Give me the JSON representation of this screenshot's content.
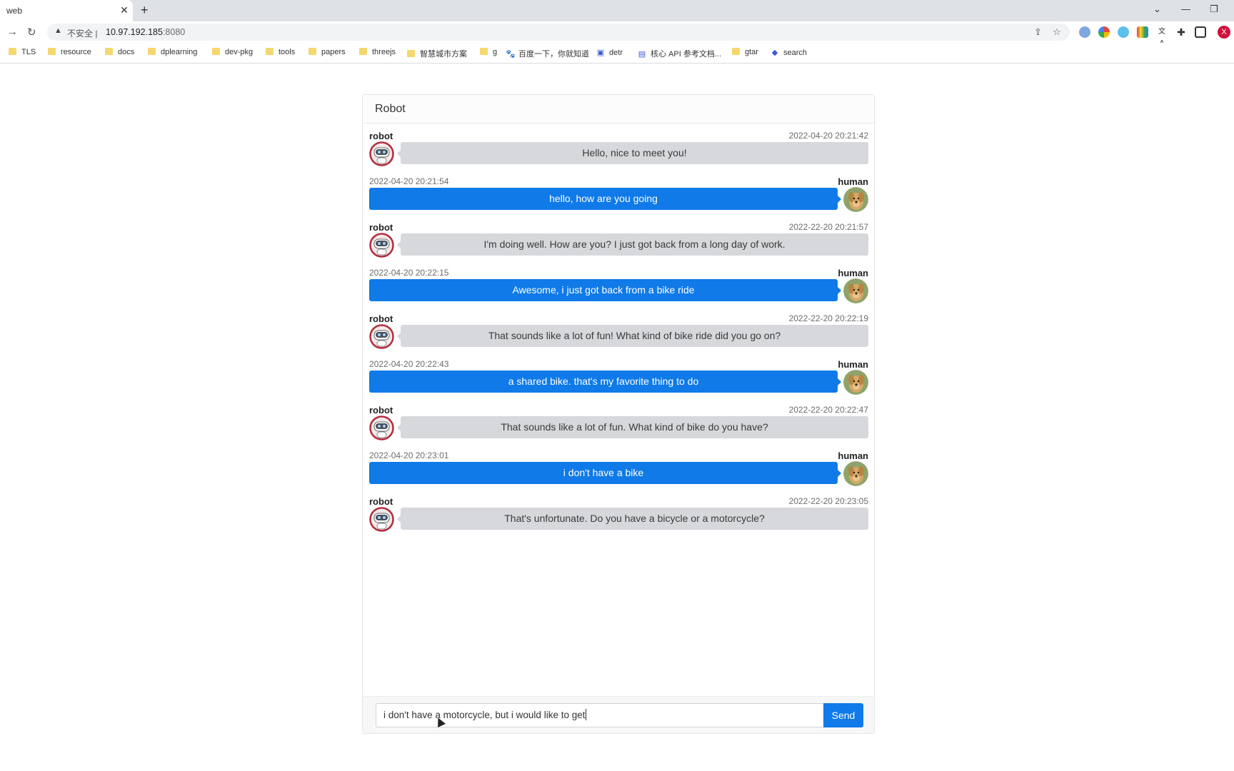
{
  "browser": {
    "tab_title": "web",
    "tab_close": "✕",
    "new_tab": "+",
    "insecure_label": "不安全 |",
    "url_host": "10.97.192.185",
    "url_port": ":8080",
    "profile_initial": "X",
    "bookmarks": [
      {
        "label": "TLS",
        "icon": "folder-icon"
      },
      {
        "label": "resource",
        "icon": "folder-icon"
      },
      {
        "label": "docs",
        "icon": "folder-icon"
      },
      {
        "label": "dplearning",
        "icon": "folder-icon"
      },
      {
        "label": "dev-pkg",
        "icon": "folder-icon"
      },
      {
        "label": "tools",
        "icon": "folder-icon"
      },
      {
        "label": "papers",
        "icon": "folder-icon"
      },
      {
        "label": "threejs",
        "icon": "folder-icon"
      },
      {
        "label": "智慧城市方案",
        "icon": "folder-icon"
      },
      {
        "label": "g",
        "icon": "folder-icon"
      },
      {
        "label": "百度一下，你就知道",
        "icon": "baidu-icon"
      },
      {
        "label": "detr",
        "icon": "robot-site-icon"
      },
      {
        "label": "核心 API 参考文档...",
        "icon": "doc-page-icon"
      },
      {
        "label": "gtar",
        "icon": "folder-icon"
      },
      {
        "label": "search",
        "icon": "search-site-icon"
      }
    ]
  },
  "chat": {
    "title": "Robot",
    "colors": {
      "robot_bubble": "#d6d8dc",
      "human_bubble": "#0f7ae8",
      "send_button": "#0f7ae8"
    },
    "messages": [
      {
        "role": "robot",
        "name": "robot",
        "time": "2022-04-20 20:21:42",
        "text": "Hello, nice to meet you!"
      },
      {
        "role": "human",
        "name": "human",
        "time": "2022-04-20 20:21:54",
        "text": "hello, how are you going"
      },
      {
        "role": "robot",
        "name": "robot",
        "time": "2022-22-20 20:21:57",
        "text": "I'm doing well. How are you? I just got back from a long day of work."
      },
      {
        "role": "human",
        "name": "human",
        "time": "2022-04-20 20:22:15",
        "text": "Awesome, i just got back from a bike ride"
      },
      {
        "role": "robot",
        "name": "robot",
        "time": "2022-22-20 20:22:19",
        "text": "That sounds like a lot of fun! What kind of bike ride did you go on?"
      },
      {
        "role": "human",
        "name": "human",
        "time": "2022-04-20 20:22:43",
        "text": "a shared bike. that's my favorite thing to do"
      },
      {
        "role": "robot",
        "name": "robot",
        "time": "2022-22-20 20:22:47",
        "text": "That sounds like a lot of fun. What kind of bike do you have?"
      },
      {
        "role": "human",
        "name": "human",
        "time": "2022-04-20 20:23:01",
        "text": "i don't have a bike"
      },
      {
        "role": "robot",
        "name": "robot",
        "time": "2022-22-20 20:23:05",
        "text": "That's unfortunate. Do you have a bicycle or a motorcycle?"
      }
    ],
    "input_value": "i don't have a motorcycle, but i would like to get",
    "send_label": "Send"
  }
}
